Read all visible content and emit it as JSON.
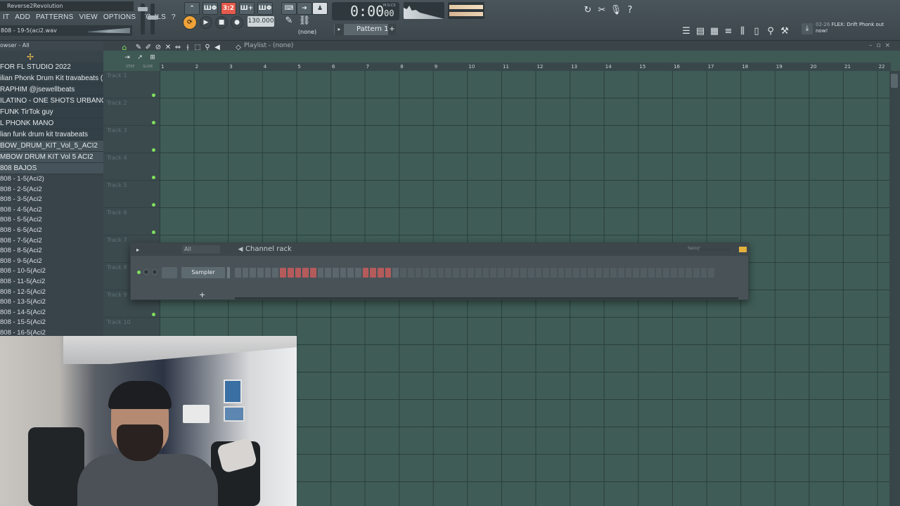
{
  "window": {
    "title_hint": "Reverse2Revolution",
    "selected_sample": "808 - 19-5(aci2.wav"
  },
  "menu": [
    "IT",
    "ADD",
    "PATTERNS",
    "VIEW",
    "OPTIONS",
    "TOOLS",
    "?"
  ],
  "transport": {
    "pat_song_label": "3:2",
    "tempo": "130.000",
    "time": "0:00",
    "time_small": "00",
    "time_unit": "M:S:CS",
    "pattern": "Pattern 1",
    "snap": "(none)"
  },
  "news": {
    "date": "02-26",
    "text": "FLEX: Drift Phonk out now!"
  },
  "browser": {
    "header": "owser - All",
    "folders": [
      {
        "label": "FOR FL STUDIO 2022",
        "selected": false
      },
      {
        "label": "ilian Phonk Drum Kit travabeats (1)",
        "selected": false
      },
      {
        "label": "RAPHIM @jsewellbeats",
        "selected": false
      },
      {
        "label": "ILATINO - ONE SHOTS URBANOS VOL. 2",
        "selected": false
      },
      {
        "label": " FUNK TirTok guy",
        "selected": false
      },
      {
        "label": "L PHONK MANO",
        "selected": false
      },
      {
        "label": "lian funk drum kit travabeats",
        "selected": false
      },
      {
        "label": "BOW_DRUM_KIT_Vol_5_ACI2",
        "selected": true
      },
      {
        "label": "MBOW DRUM KIT Vol 5 ACI2",
        "selected": true
      },
      {
        "label": "808 BAJOS",
        "selected": true
      }
    ],
    "files": [
      "808 - 1-5(Aci2)",
      "808 - 2-5(Aci2",
      "808 - 3-5(Aci2",
      "808 - 4-5(Aci2",
      "808 - 5-5(Aci2",
      "808 - 6-5(Aci2",
      "808 - 7-5(Aci2",
      "808 - 8-5(Aci2",
      "808 - 9-5(Aci2",
      "808 - 10-5(Aci2",
      "808 - 11-5(Aci2",
      "808 - 12-5(Aci2",
      "808 - 13-5(Aci2",
      "808 - 14-5(Aci2",
      "808 - 15-5(Aci2",
      "808 - 16-5(Aci2"
    ]
  },
  "playlist": {
    "title": "Playlist - (none)",
    "ruler": [
      "1",
      "2",
      "3",
      "4",
      "5",
      "6",
      "7",
      "8",
      "9",
      "10",
      "11",
      "12",
      "13",
      "14",
      "15",
      "16",
      "17",
      "18",
      "19",
      "20",
      "21",
      "22"
    ],
    "tracks": [
      "Track 1",
      "Track 2",
      "Track 3",
      "Track 4",
      "Track 5",
      "Track 6",
      "Track 7",
      "Track 8",
      "Track 9",
      "Track 10"
    ],
    "tool_labels": [
      "STEP",
      "SLIDE"
    ]
  },
  "channel_rack": {
    "title": "Channel rack",
    "filter": "All",
    "swing_label": "Swing",
    "channel_name": "Sampler",
    "add_label": "+",
    "step_count": 64,
    "steps_lit": [
      6,
      7,
      8,
      9,
      10,
      17,
      18,
      19,
      20
    ]
  },
  "colors": {
    "accent_orange": "#f0a238",
    "pat_red": "#e45a4c",
    "led_green": "#7fe05d",
    "grid_bg": "#3f5c56"
  }
}
